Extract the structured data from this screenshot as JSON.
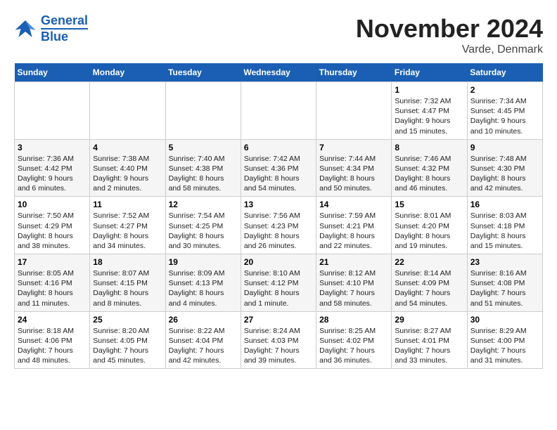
{
  "header": {
    "logo_line1": "General",
    "logo_line2": "Blue",
    "month": "November 2024",
    "location": "Varde, Denmark"
  },
  "weekdays": [
    "Sunday",
    "Monday",
    "Tuesday",
    "Wednesday",
    "Thursday",
    "Friday",
    "Saturday"
  ],
  "weeks": [
    [
      {
        "day": "",
        "info": ""
      },
      {
        "day": "",
        "info": ""
      },
      {
        "day": "",
        "info": ""
      },
      {
        "day": "",
        "info": ""
      },
      {
        "day": "",
        "info": ""
      },
      {
        "day": "1",
        "info": "Sunrise: 7:32 AM\nSunset: 4:47 PM\nDaylight: 9 hours and 15 minutes."
      },
      {
        "day": "2",
        "info": "Sunrise: 7:34 AM\nSunset: 4:45 PM\nDaylight: 9 hours and 10 minutes."
      }
    ],
    [
      {
        "day": "3",
        "info": "Sunrise: 7:36 AM\nSunset: 4:42 PM\nDaylight: 9 hours and 6 minutes."
      },
      {
        "day": "4",
        "info": "Sunrise: 7:38 AM\nSunset: 4:40 PM\nDaylight: 9 hours and 2 minutes."
      },
      {
        "day": "5",
        "info": "Sunrise: 7:40 AM\nSunset: 4:38 PM\nDaylight: 8 hours and 58 minutes."
      },
      {
        "day": "6",
        "info": "Sunrise: 7:42 AM\nSunset: 4:36 PM\nDaylight: 8 hours and 54 minutes."
      },
      {
        "day": "7",
        "info": "Sunrise: 7:44 AM\nSunset: 4:34 PM\nDaylight: 8 hours and 50 minutes."
      },
      {
        "day": "8",
        "info": "Sunrise: 7:46 AM\nSunset: 4:32 PM\nDaylight: 8 hours and 46 minutes."
      },
      {
        "day": "9",
        "info": "Sunrise: 7:48 AM\nSunset: 4:30 PM\nDaylight: 8 hours and 42 minutes."
      }
    ],
    [
      {
        "day": "10",
        "info": "Sunrise: 7:50 AM\nSunset: 4:29 PM\nDaylight: 8 hours and 38 minutes."
      },
      {
        "day": "11",
        "info": "Sunrise: 7:52 AM\nSunset: 4:27 PM\nDaylight: 8 hours and 34 minutes."
      },
      {
        "day": "12",
        "info": "Sunrise: 7:54 AM\nSunset: 4:25 PM\nDaylight: 8 hours and 30 minutes."
      },
      {
        "day": "13",
        "info": "Sunrise: 7:56 AM\nSunset: 4:23 PM\nDaylight: 8 hours and 26 minutes."
      },
      {
        "day": "14",
        "info": "Sunrise: 7:59 AM\nSunset: 4:21 PM\nDaylight: 8 hours and 22 minutes."
      },
      {
        "day": "15",
        "info": "Sunrise: 8:01 AM\nSunset: 4:20 PM\nDaylight: 8 hours and 19 minutes."
      },
      {
        "day": "16",
        "info": "Sunrise: 8:03 AM\nSunset: 4:18 PM\nDaylight: 8 hours and 15 minutes."
      }
    ],
    [
      {
        "day": "17",
        "info": "Sunrise: 8:05 AM\nSunset: 4:16 PM\nDaylight: 8 hours and 11 minutes."
      },
      {
        "day": "18",
        "info": "Sunrise: 8:07 AM\nSunset: 4:15 PM\nDaylight: 8 hours and 8 minutes."
      },
      {
        "day": "19",
        "info": "Sunrise: 8:09 AM\nSunset: 4:13 PM\nDaylight: 8 hours and 4 minutes."
      },
      {
        "day": "20",
        "info": "Sunrise: 8:10 AM\nSunset: 4:12 PM\nDaylight: 8 hours and 1 minute."
      },
      {
        "day": "21",
        "info": "Sunrise: 8:12 AM\nSunset: 4:10 PM\nDaylight: 7 hours and 58 minutes."
      },
      {
        "day": "22",
        "info": "Sunrise: 8:14 AM\nSunset: 4:09 PM\nDaylight: 7 hours and 54 minutes."
      },
      {
        "day": "23",
        "info": "Sunrise: 8:16 AM\nSunset: 4:08 PM\nDaylight: 7 hours and 51 minutes."
      }
    ],
    [
      {
        "day": "24",
        "info": "Sunrise: 8:18 AM\nSunset: 4:06 PM\nDaylight: 7 hours and 48 minutes."
      },
      {
        "day": "25",
        "info": "Sunrise: 8:20 AM\nSunset: 4:05 PM\nDaylight: 7 hours and 45 minutes."
      },
      {
        "day": "26",
        "info": "Sunrise: 8:22 AM\nSunset: 4:04 PM\nDaylight: 7 hours and 42 minutes."
      },
      {
        "day": "27",
        "info": "Sunrise: 8:24 AM\nSunset: 4:03 PM\nDaylight: 7 hours and 39 minutes."
      },
      {
        "day": "28",
        "info": "Sunrise: 8:25 AM\nSunset: 4:02 PM\nDaylight: 7 hours and 36 minutes."
      },
      {
        "day": "29",
        "info": "Sunrise: 8:27 AM\nSunset: 4:01 PM\nDaylight: 7 hours and 33 minutes."
      },
      {
        "day": "30",
        "info": "Sunrise: 8:29 AM\nSunset: 4:00 PM\nDaylight: 7 hours and 31 minutes."
      }
    ]
  ]
}
